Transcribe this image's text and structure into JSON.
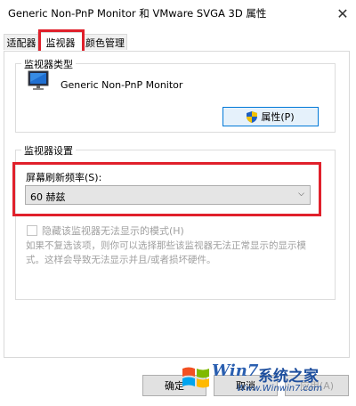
{
  "window": {
    "title": "Generic Non-PnP Monitor 和 VMware SVGA 3D 属性",
    "close_glyph": "✕"
  },
  "tabs": [
    {
      "label": "适配器"
    },
    {
      "label": "监视器"
    },
    {
      "label": "颜色管理"
    }
  ],
  "monitor_type": {
    "group_label": "监视器类型",
    "monitor_name": "Generic Non-PnP Monitor",
    "properties_button": "属性(P)",
    "properties_icon": "shield-icon"
  },
  "monitor_settings": {
    "group_label": "监视器设置",
    "refresh_label": "屏幕刷新频率(S):",
    "refresh_value": "60 赫兹",
    "hide_modes_label": "隐藏该监视器无法显示的模式(H)",
    "hide_modes_checked": false,
    "note": "如果不复选该项，则你可以选择那些该监视器无法正常显示的显示模式。这样会导致无法显示并且/或者损坏硬件。"
  },
  "footer": {
    "ok_button": "确定",
    "cancel_button": "取消",
    "apply_button": "应用(A)"
  },
  "watermark": {
    "logo_text": "Win7",
    "site_text": "系统之家",
    "url": "Www.Winwin7.com"
  },
  "colors": {
    "highlight": "#e0202b",
    "focus": "#0078d7",
    "disabled_text": "#a0a0a0"
  }
}
